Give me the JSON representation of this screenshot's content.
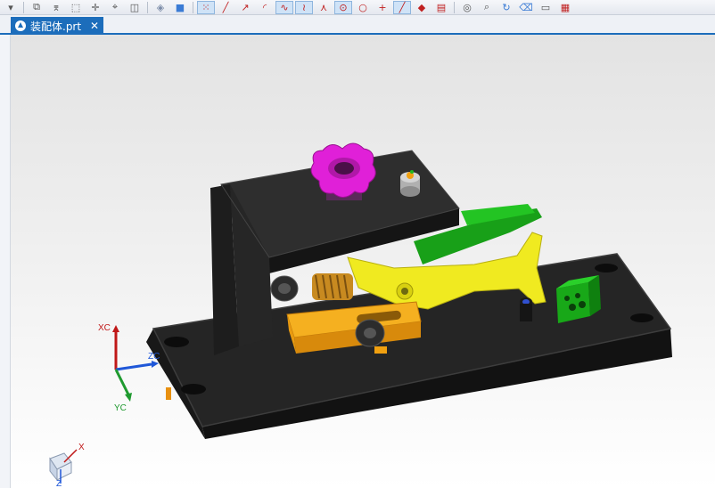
{
  "tab": {
    "title": "装配体.prt",
    "close": "✕"
  },
  "toolbar": {
    "icons": [
      "dropdown-icon",
      "copy-icon",
      "filter-icon",
      "select-icon",
      "point-icon",
      "snap-icon",
      "box-select-icon",
      "shade-icon",
      "solid-icon",
      "grid-snap-icon",
      "line-icon",
      "arrow-icon",
      "arc-icon",
      "spline-icon",
      "curve-icon",
      "fork-icon",
      "center-icon",
      "circle-icon",
      "cross-icon",
      "diag-icon",
      "fill-icon",
      "stack-icon",
      "view-icon",
      "magnify-icon",
      "refresh-icon",
      "eraser-icon",
      "display-icon",
      "color-icon"
    ]
  },
  "triad": {
    "xc": "XC",
    "yc": "YC",
    "zc": "ZC"
  },
  "mini_triad": {
    "x": "X",
    "z": "Z"
  },
  "colors": {
    "tab_blue": "#1c6dbb",
    "knob_magenta": "#e020d8",
    "lever_yellow": "#f0ea20",
    "clamp_orange": "#f0a010",
    "block_green": "#1fb81f",
    "base_black": "#1b1b1b"
  }
}
